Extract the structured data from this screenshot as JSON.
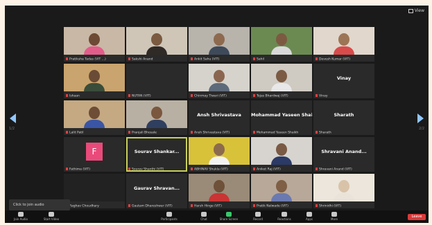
{
  "window": {
    "view_label": "View"
  },
  "navigation": {
    "left_page": "1/2",
    "right_page": "2/2"
  },
  "participants": [
    {
      "name": "Pratiksha Tadas (VIT ...)",
      "type": "video",
      "skin": "#6d4a35",
      "shirt": "#e35d8b",
      "bg": "#c9b8a6"
    },
    {
      "name": "Sakshi Anand",
      "type": "video",
      "skin": "#7a5a40",
      "shirt": "#2f2a26",
      "bg": "#cfc6b8"
    },
    {
      "name": "Ankit Sahu (VIT)",
      "type": "video",
      "skin": "#8d6a4e",
      "shirt": "#3e4a5a",
      "bg": "#b8b3ab"
    },
    {
      "name": "Sahil",
      "type": "video",
      "skin": "#7c5a41",
      "shirt": "#d9d9d9",
      "bg": "#6b8a52"
    },
    {
      "name": "Devesh Kumar (VIT)",
      "type": "video",
      "skin": "#9c7556",
      "shirt": "#d94b4b",
      "bg": "#e1d7cc"
    },
    {
      "name": "Ishaan",
      "type": "video",
      "skin": "#6a4b35",
      "shirt": "#3a4d3a",
      "bg": "#c9a46e"
    },
    {
      "name": "NUTAN (VIT)",
      "type": "video",
      "skin": "#2a2a2a",
      "shirt": "#2a2a2a",
      "bg": "#2a2a2a"
    },
    {
      "name": "Chinmay Tiwari (VIT)",
      "type": "video",
      "skin": "#8a6650",
      "shirt": "#5d6a7a",
      "bg": "#d6d3cd"
    },
    {
      "name": "Tejas Bhardwaj (VIT)",
      "type": "video",
      "skin": "#7b5b43",
      "shirt": "#e8e8e8",
      "bg": "#cfcac2"
    },
    {
      "name": "Vinay",
      "type": "name",
      "label": "Vinay"
    },
    {
      "name": "Lalit Patil",
      "type": "video",
      "skin": "#6e4d36",
      "shirt": "#3a55a5",
      "bg": "#c4a982"
    },
    {
      "name": "Pranjali Bhosale",
      "type": "video",
      "skin": "#7a573e",
      "shirt": "#2f3f5f",
      "bg": "#b9b0a4"
    },
    {
      "name": "Ansh Shrivastava (VIT)",
      "type": "name",
      "label": "Ansh Shrivastava"
    },
    {
      "name": "Mohammad Yaseen Shaikh",
      "type": "name",
      "label": "Mohammad Yaseen Shaikh"
    },
    {
      "name": "Sharath",
      "type": "name",
      "label": "Sharath"
    },
    {
      "name": "Fathima (VIT)",
      "type": "avatar",
      "letter": "F"
    },
    {
      "name": "Sourav Shanthi (VIT)",
      "type": "name",
      "label": "Sourav Shankar...",
      "active": true
    },
    {
      "name": "ABHINAV Shukla (VIT)",
      "type": "video",
      "skin": "#8b6b4c",
      "shirt": "#f2f2f2",
      "bg": "#d8c23a"
    },
    {
      "name": "Aniket Raj (VIT)",
      "type": "video",
      "skin": "#7a5a44",
      "shirt": "#2b3a66",
      "bg": "#d7d4cf"
    },
    {
      "name": "Shravani Anand (VIT)",
      "type": "name",
      "label": "Shravani Anand..."
    },
    {
      "name": "Raghav Choudhary",
      "type": "video",
      "skin": "#222222",
      "shirt": "#222222",
      "bg": "#222222"
    },
    {
      "name": "Gautam Dhareshwar (VIT)",
      "type": "name",
      "label": "Gaurav Shravan..."
    },
    {
      "name": "Harsh Hinge (VIT)",
      "type": "video",
      "skin": "#6f5038",
      "shirt": "#c93434",
      "bg": "#9a8a78"
    },
    {
      "name": "Pratik Nalwade (VIT)",
      "type": "video",
      "skin": "#7f5f45",
      "shirt": "#6a7ab0",
      "bg": "#b8a89a"
    },
    {
      "name": "Shrinidhi (VIT)",
      "type": "video",
      "skin": "#d9c3a8",
      "shirt": "#e9e3d9",
      "bg": "#ece6dc"
    }
  ],
  "toast": "Click to join audio",
  "toolbar": {
    "items": [
      "Join Audio",
      "Start Video",
      "Participants",
      "Chat",
      "Share Screen",
      "Record",
      "Reactions",
      "Apps",
      "More"
    ],
    "leave": "Leave"
  }
}
